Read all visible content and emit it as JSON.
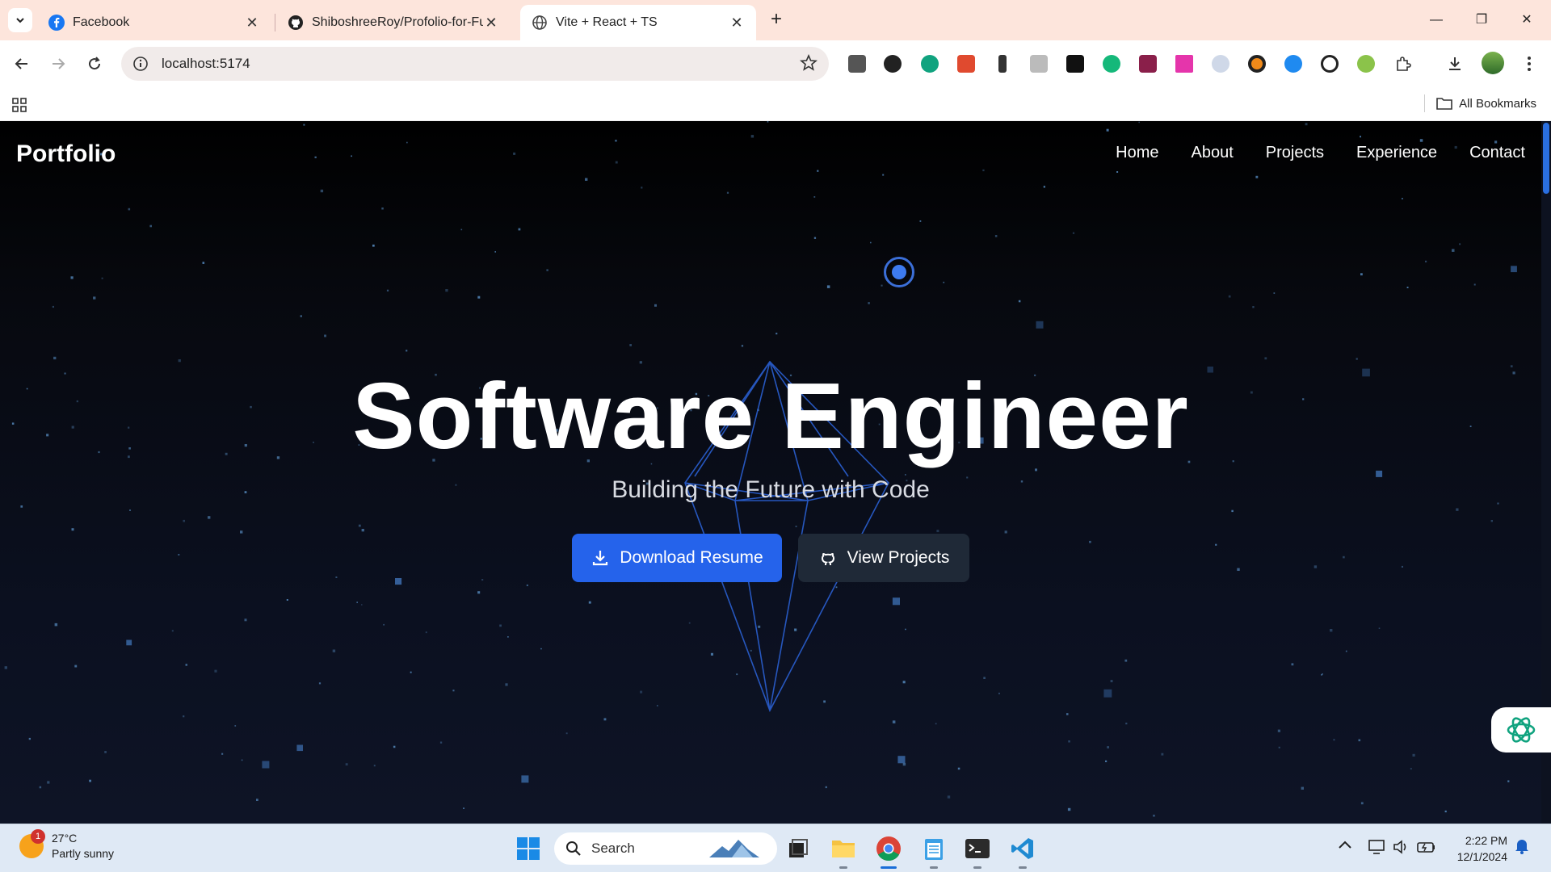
{
  "browser": {
    "tabs": [
      {
        "title": "Facebook",
        "icon": "facebook-icon"
      },
      {
        "title": "ShiboshreeRoy/Profolio-for-Full",
        "icon": "github-icon"
      },
      {
        "title": "Vite + React + TS",
        "icon": "globe-icon"
      }
    ],
    "address": "localhost:5174",
    "bookmarks_label": "All Bookmarks"
  },
  "site": {
    "logo": "Portfolio",
    "nav": [
      "Home",
      "About",
      "Projects",
      "Experience",
      "Contact"
    ],
    "hero": {
      "title": "Software Engineer",
      "subtitle": "Building the Future with Code",
      "primary_button": "Download Resume",
      "secondary_button": "View Projects"
    }
  },
  "taskbar": {
    "weather_temp": "27°C",
    "weather_desc": "Partly sunny",
    "weather_badge": "1",
    "search_label": "Search",
    "time": "2:22 PM",
    "date": "12/1/2024"
  },
  "colors": {
    "accent": "#2563eb",
    "tab_strip": "#fde5dc",
    "page_bg": "#0a0e1a"
  }
}
